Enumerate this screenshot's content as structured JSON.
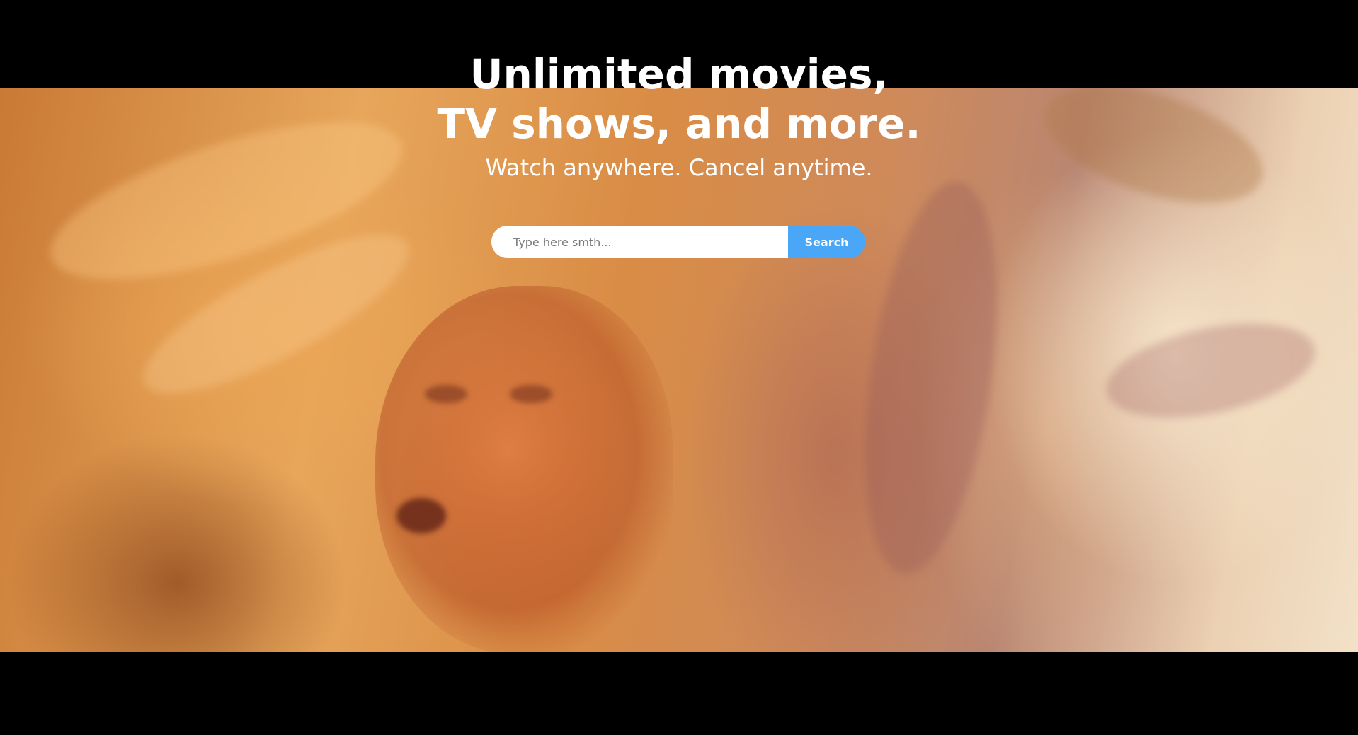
{
  "hero": {
    "headline_line1": "Unlimited movies,",
    "headline_line2": "TV shows, and more.",
    "subheadline": "Watch anywhere. Cancel anytime."
  },
  "search": {
    "placeholder": "Type here smth...",
    "value": "",
    "button_label": "Search"
  },
  "colors": {
    "background": "#000000",
    "text": "#ffffff",
    "search_button": "#4aa6f7"
  },
  "icons": []
}
